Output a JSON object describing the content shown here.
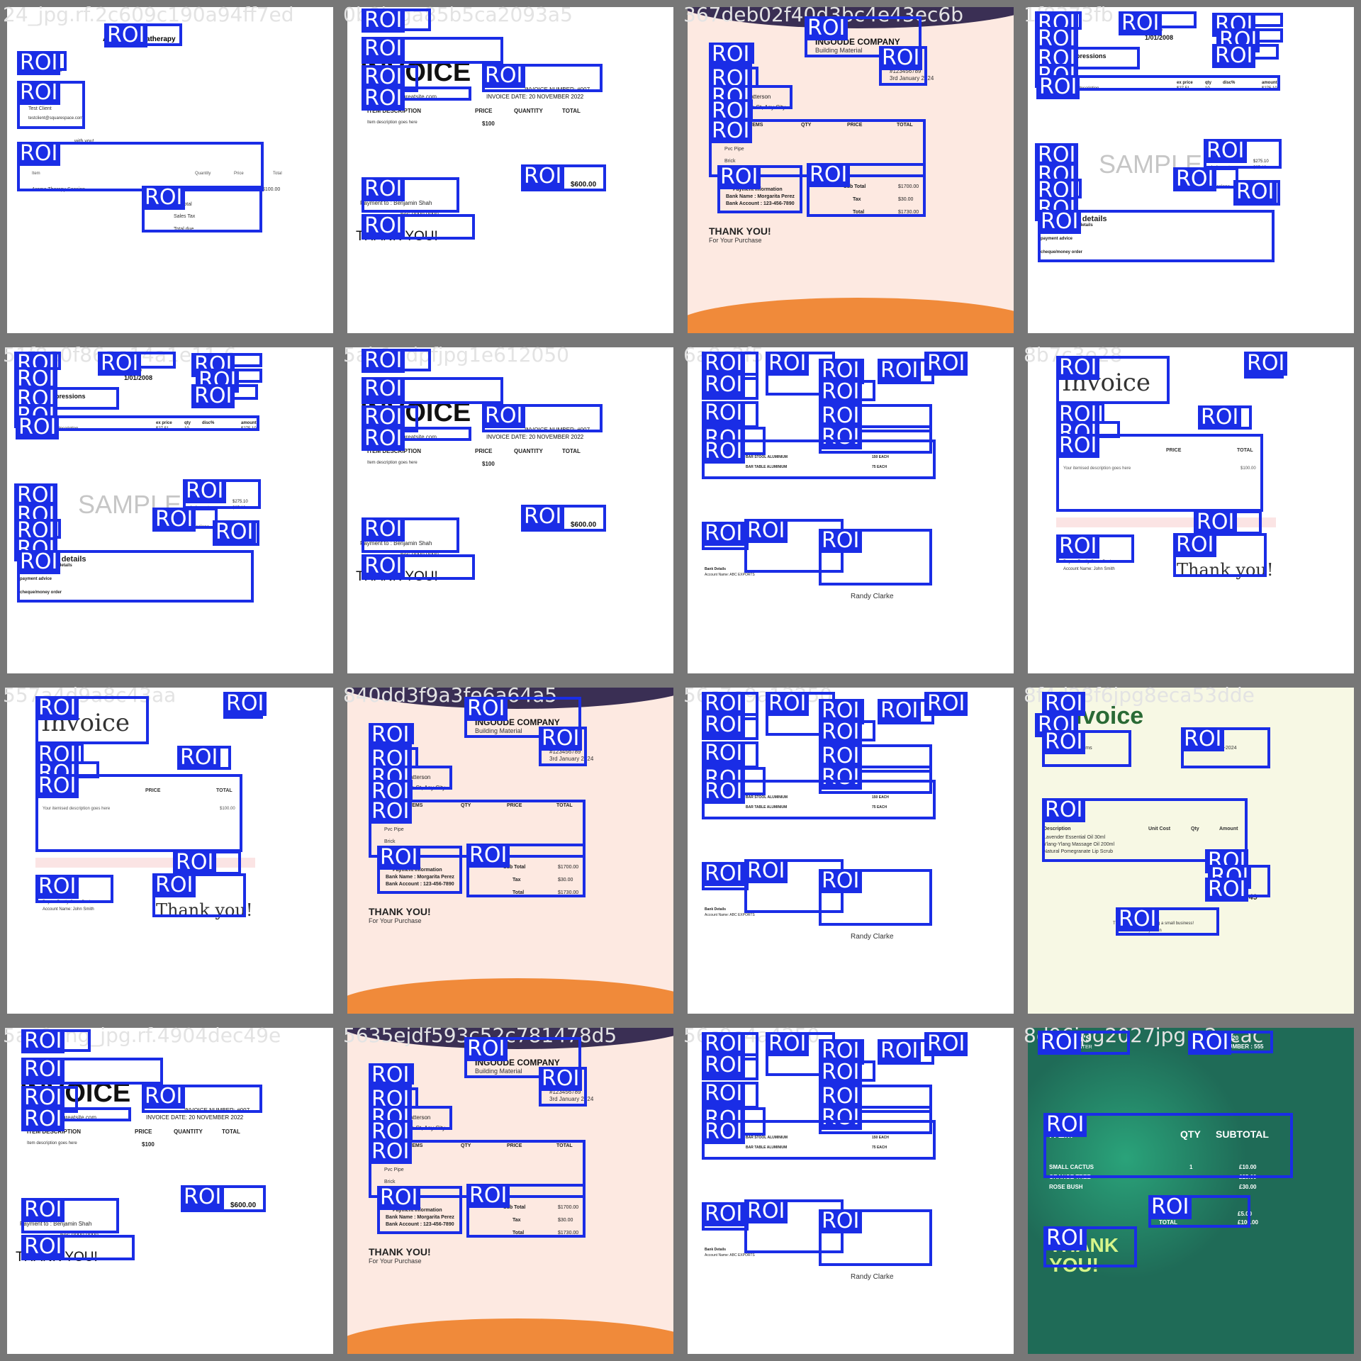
{
  "roi_label": "ROI",
  "colors": {
    "roi": "#1a2de6",
    "frame": "#777777"
  },
  "tiles": [
    {
      "file": "24_jpg.rf.2c609c190a94ff7ed",
      "style": "aroma",
      "texts": [
        "Alma's Aromatherapy",
        "Invoice 100006",
        "Bill To",
        "Test Client",
        "testclient@squarespace.com",
        "with you!",
        "Item",
        "Quantity",
        "Price",
        "Total",
        "Aroma Therapy Session",
        "$100.00",
        "$100.00",
        "Subtotal",
        "Sales Tax",
        "Total due"
      ]
    },
    {
      "file": "0b0jpga85b5ca2093a5",
      "style": "classic",
      "texts": [
        "INVOICE",
        "VA",
        "greatsite.com",
        "INVOICE NUMBER: #007",
        "INVOICE DATE: 20 NOVEMBER 2022",
        "ITEM DESCRIPTION",
        "PRICE",
        "QUANTITY",
        "TOTAL",
        "Item description goes here",
        "$100",
        "TOTAL",
        "$600.00",
        "Payment to : Benjamin Shah",
        "ber: 0000 0000",
        "THANK YOU!"
      ]
    },
    {
      "file": "367deb02f40d3bc4e43ec6b",
      "style": "ingoude",
      "texts": [
        "INGOUDE COMPANY",
        "Building Material",
        "#123456789",
        "3rd January 2024",
        "Jonathan Patterson",
        "e St, Any City",
        "NO",
        "ITEMS",
        "QTY",
        "PRICE",
        "TOTAL",
        "Cement",
        "Pvc Pipe",
        "Brick",
        "Payment Information",
        "Bank Name : Morgarita Perez",
        "Bank Account : 123-456-7890",
        "Sub Total",
        "$1700.00",
        "Tax",
        "$30.00",
        "Total",
        "$1730.00",
        "THANK YOU!",
        "For Your Purchase"
      ]
    },
    {
      "file": "1f8373fb",
      "style": "accurate",
      "texts": [
        "Accurate Expressions",
        "dates of issue",
        "1/01/2008",
        "payment due by",
        "29/02/2008",
        "description",
        "ex price",
        "qty",
        "disc%",
        "amount",
        "ITEM1",
        "Item description",
        "$27.51",
        "10",
        "$275.10",
        "SAMPLE",
        "invoice total",
        "$275.10",
        "includes gst",
        "$25.10",
        "nd impressions",
        "www.accurateexpressions",
        "Sydney NSW 2000",
        "remittance details",
        "electronic banking details",
        "payment advice",
        "cheque/money order"
      ]
    },
    {
      "file": "51f8e0f86ae14a1e11-6",
      "style": "accurate",
      "texts": [
        "Accurate Expressions",
        "dates of issue",
        "1/01/2008",
        "payment due by",
        "29/02/2008",
        "description",
        "ex price",
        "qty",
        "disc%",
        "amount",
        "ITEM1",
        "Item description",
        "$27.51",
        "10",
        "$275.10",
        "SAMPLE",
        "invoice total",
        "$275.10",
        "includes gst",
        "$25.10",
        "nd impressions",
        "www.accurateexpressions",
        "Sydney NSW 2000",
        "remittance details",
        "electronic banking details",
        "payment advice",
        "cheque/money order"
      ]
    },
    {
      "file": "5ab1pdpfjpg1e612050",
      "style": "classic",
      "texts": [
        "INVOICE",
        "VA",
        "greatsite.com",
        "INVOICE NUMBER: #007",
        "INVOICE DATE: 20 NOVEMBER 2022",
        "ITEM DESCRIPTION",
        "PRICE",
        "QUANTITY",
        "TOTAL",
        "Item description goes here",
        "$100",
        "TOTAL",
        "$600.00",
        "Payment to : Benjamin Shah",
        "ber: 0000 0000",
        "THANK YOU!"
      ]
    },
    {
      "file": "6a8c3f5",
      "style": "abc",
      "texts": [
        "ABC Exports",
        "BAR STOOL ALUMINIUM",
        "BAR TABLE ALUMINIUM",
        "150 EACH",
        "75 EACH",
        "Bank Details",
        "Account Name: ABC EXPORTS",
        "Randy Clarke"
      ]
    },
    {
      "file": "8b7c3e28",
      "style": "script",
      "texts": [
        "Invoice",
        "LOGO",
        "To: John Smith",
        "Invoice #00000",
        "DESCRIPTION",
        "PRICE",
        "TOTAL",
        "Your itemised description goes here",
        "$100.00",
        "Pay to: Really Great Bank",
        "Account Name: John Smith",
        "Thank you!"
      ]
    },
    {
      "file": "557a4d9a8c43aa",
      "style": "script",
      "texts": [
        "Invoice",
        "LOGO",
        "To: John Smith",
        "Invoice #00000",
        "DESCRIPTION",
        "PRICE",
        "TOTAL",
        "Your itemised description goes here",
        "$100.00",
        "Pay to: Really Great Bank",
        "Account Name: John Smith",
        "Thank you!"
      ]
    },
    {
      "file": "840dd3f9a3fe6a64a5",
      "style": "ingoude",
      "texts": [
        "INGOUDE COMPANY",
        "Building Material",
        "#123456789",
        "3rd January 2024",
        "Jonathan Patterson",
        "e St, Any City",
        "NO",
        "ITEMS",
        "QTY",
        "PRICE",
        "TOTAL",
        "Cement",
        "Pvc Pipe",
        "Brick",
        "Payment Information",
        "Bank Name : Morgarita Perez",
        "Bank Account : 123-456-7890",
        "Sub Total",
        "$1700.00",
        "Tax",
        "$30.00",
        "Total",
        "$1730.00",
        "THANK YOU!",
        "For Your Purchase"
      ]
    },
    {
      "file": "56c7e9a13250",
      "style": "abc",
      "texts": [
        "ABC Exports",
        "BAR STOOL ALUMINIUM",
        "BAR TABLE ALUMINIUM",
        "150 EACH",
        "75 EACH",
        "Bank Details",
        "Account Name: ABC EXPORTS",
        "Randy Clarke"
      ]
    },
    {
      "file": "8f4d28f6jpg8eca53dde",
      "style": "mara",
      "texts": [
        "Invoice",
        "Issued to",
        "Mara's Beauty Rooms",
        "Ref. #1829",
        "Date: 07-10-2024",
        "Description",
        "Unit Cost",
        "Qty",
        "Amount",
        "Lavender Essential Oil 30ml",
        "Ylang-Ylang Massage Oil 200ml",
        "Natural Pomegranate Lip Scrub",
        "Subtotal : $61.50",
        "Total : $61.49",
        "Thank you for supporting a small business!",
        "Holly Stein"
      ]
    },
    {
      "file": "5ae0png_jpg.rf.4904dec49e",
      "style": "classic",
      "texts": [
        "INVOICE",
        "VA",
        "greatsite.com",
        "INVOICE NUMBER: #007",
        "INVOICE DATE: 20 NOVEMBER 2022",
        "ITEM DESCRIPTION",
        "PRICE",
        "QUANTITY",
        "TOTAL",
        "Item description goes here",
        "$100",
        "TOTAL",
        "$600.00",
        "Payment to : Benjamin Shah",
        "ber: 0000 0000",
        "THANK YOU!"
      ]
    },
    {
      "file": "5635ejdf593c52c781478d5",
      "style": "ingoude",
      "texts": [
        "INGOUDE COMPANY",
        "Building Material",
        "#123456789",
        "3rd January 2024",
        "Jonathan Patterson",
        "e St, Any City",
        "NO",
        "ITEMS",
        "QTY",
        "PRICE",
        "TOTAL",
        "Cement",
        "Pvc Pipe",
        "Brick",
        "Payment Information",
        "Bank Name : Morgarita Perez",
        "Bank Account : 123-456-7890",
        "Sub Total",
        "$1700.00",
        "Tax",
        "$30.00",
        "Total",
        "$1730.00",
        "THANK YOU!",
        "For Your Purchase"
      ]
    },
    {
      "file": "56c9e4a4250",
      "style": "abc",
      "texts": [
        "ABC Exports",
        "BAR STOOL ALUMINIUM",
        "BAR TABLE ALUMINIUM",
        "150 EACH",
        "75 EACH",
        "Bank Details",
        "Account Name: ABC EXPORTS",
        "Randy Clarke"
      ]
    },
    {
      "file": "8d96jpg2027jpg.e2acac",
      "style": "garden",
      "texts": [
        "SHELBY'S",
        "GARDEN CENTER",
        "DATE: 01/04/20",
        "RECEIPT NUMBER : 555",
        "ITEM",
        "QTY",
        "SUBTOTAL",
        "SMALL CACTUS",
        "ORANGE TREE",
        "ROSE BUSH",
        "1",
        "£10.00",
        "£25.00",
        "£30.00",
        "TAX",
        "TOTAL",
        "£5.00",
        "£100.00",
        "THANK",
        "YOU!"
      ]
    }
  ]
}
